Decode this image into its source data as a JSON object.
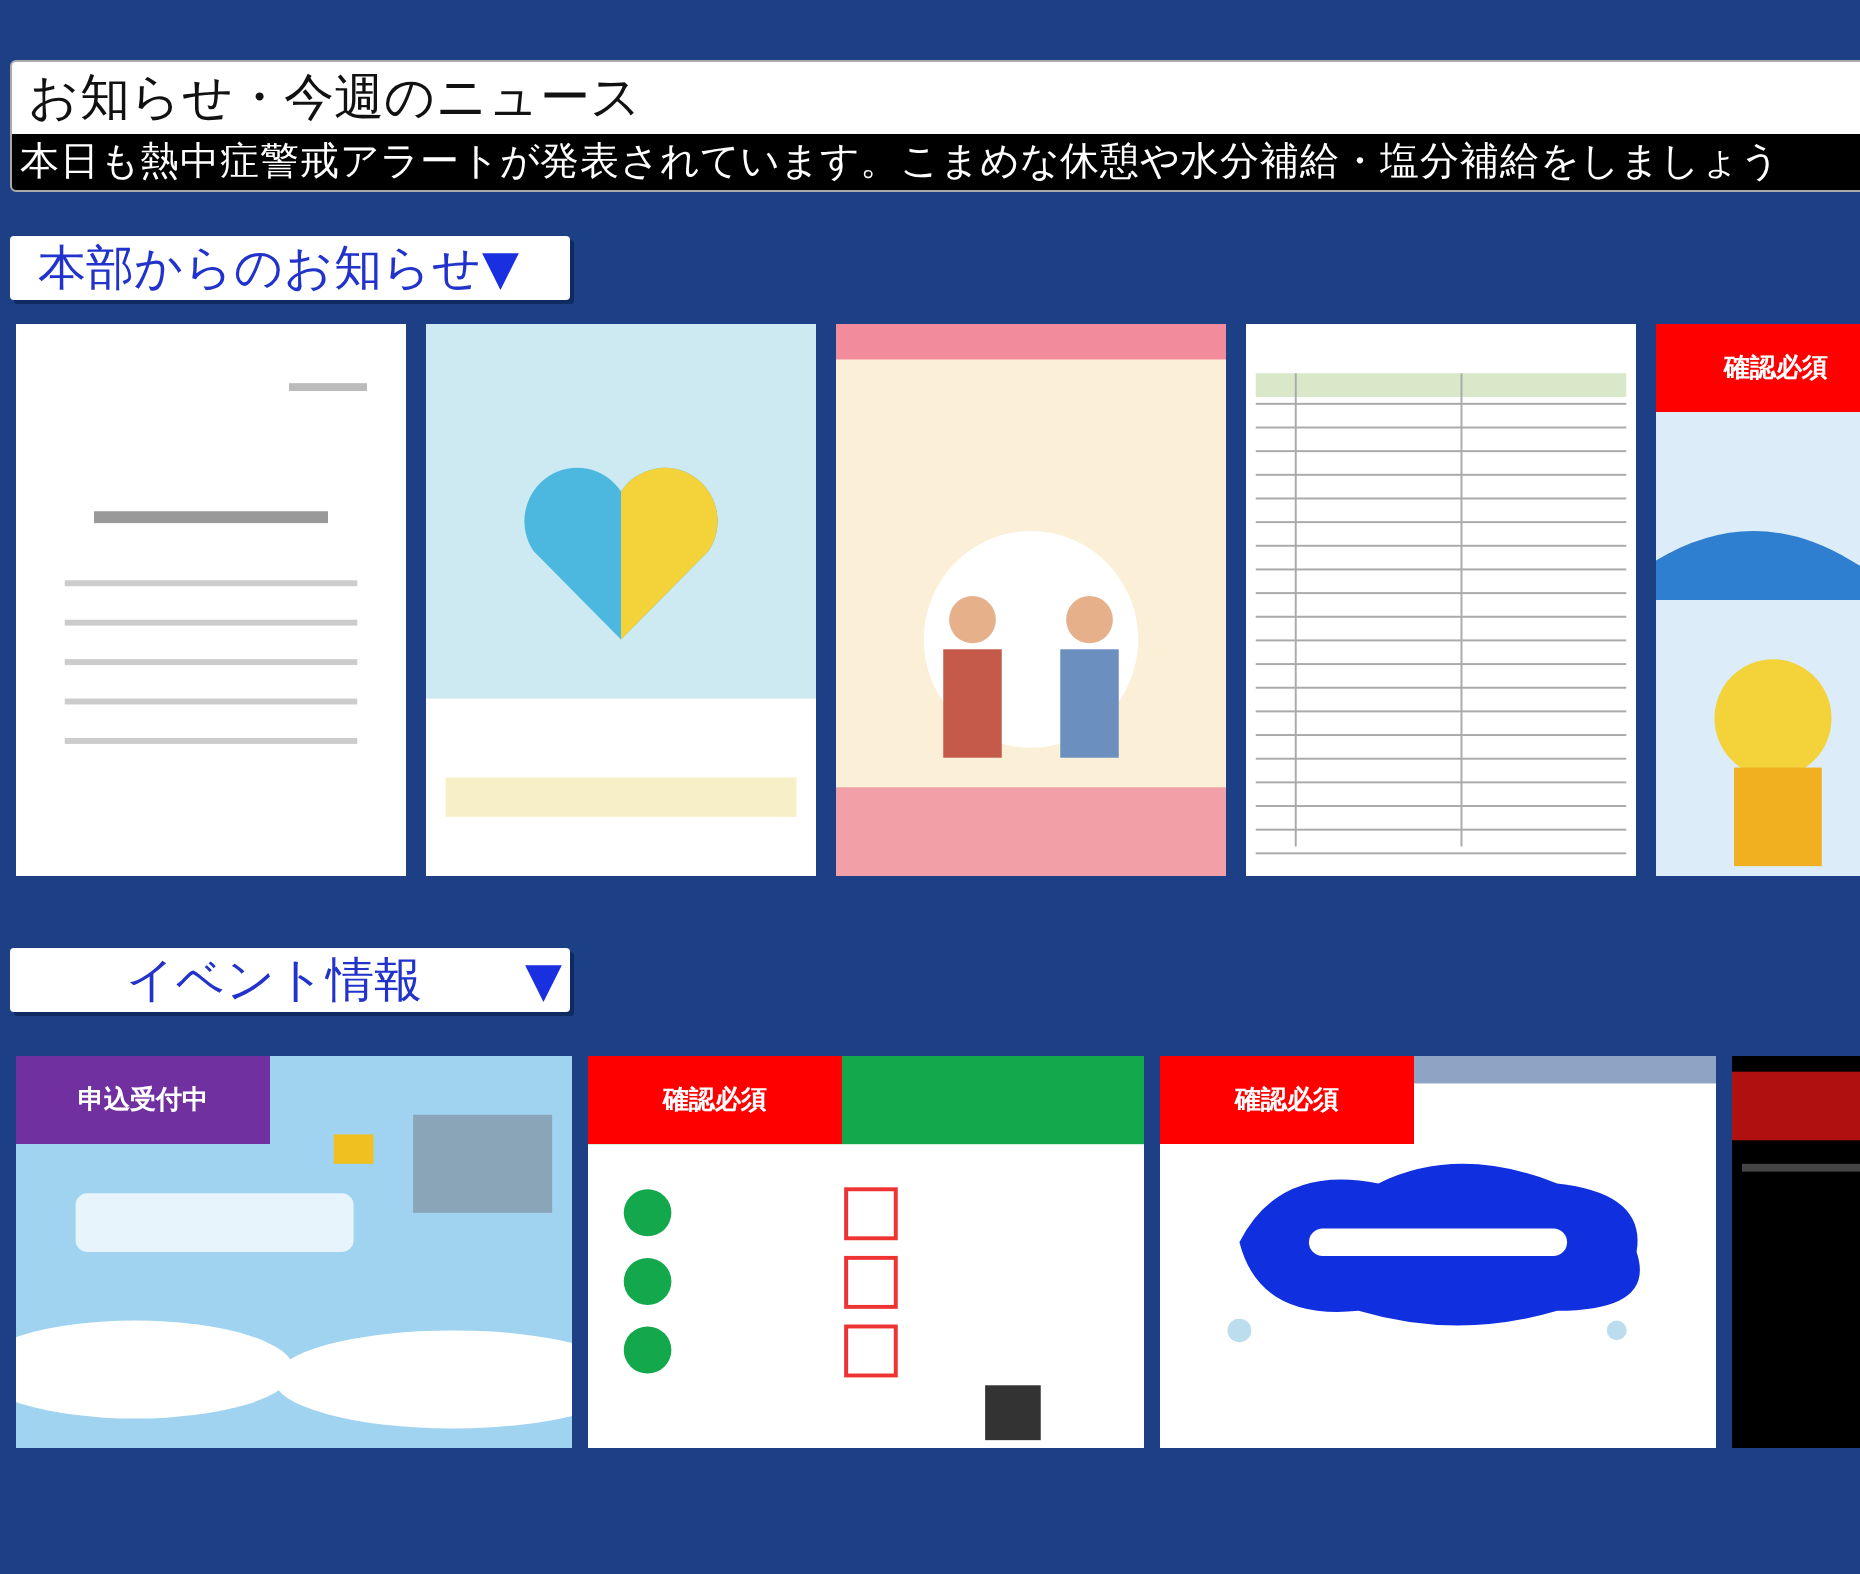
{
  "header": {
    "title": "お知らせ・今週のニュース",
    "ticker": "本日も熱中症警戒アラートが発表されています。こまめな休憩や水分補給・塩分補給をしましょう"
  },
  "sections": [
    {
      "title": "本部からのお知らせ",
      "arrow": "▼",
      "kind": "documents",
      "cards": [
        {
          "kind": "picture"
        },
        {
          "kind": "picture"
        },
        {
          "kind": "picture"
        },
        {
          "kind": "picture"
        },
        {
          "kind": "picture",
          "badge": {
            "label": "確認必須",
            "color": "#ff0000"
          }
        }
      ]
    },
    {
      "title": "イベント情報",
      "arrow": "▼",
      "kind": "events",
      "cards": [
        {
          "kind": "picture",
          "badge": {
            "label": "申込受付中",
            "color": "#7030a0"
          }
        },
        {
          "kind": "picture",
          "badge": {
            "label": "確認必須",
            "color": "#ff0000"
          }
        },
        {
          "kind": "picture",
          "badge": {
            "label": "確認必須",
            "color": "#ff0000"
          }
        },
        {
          "kind": "picture"
        }
      ]
    }
  ]
}
